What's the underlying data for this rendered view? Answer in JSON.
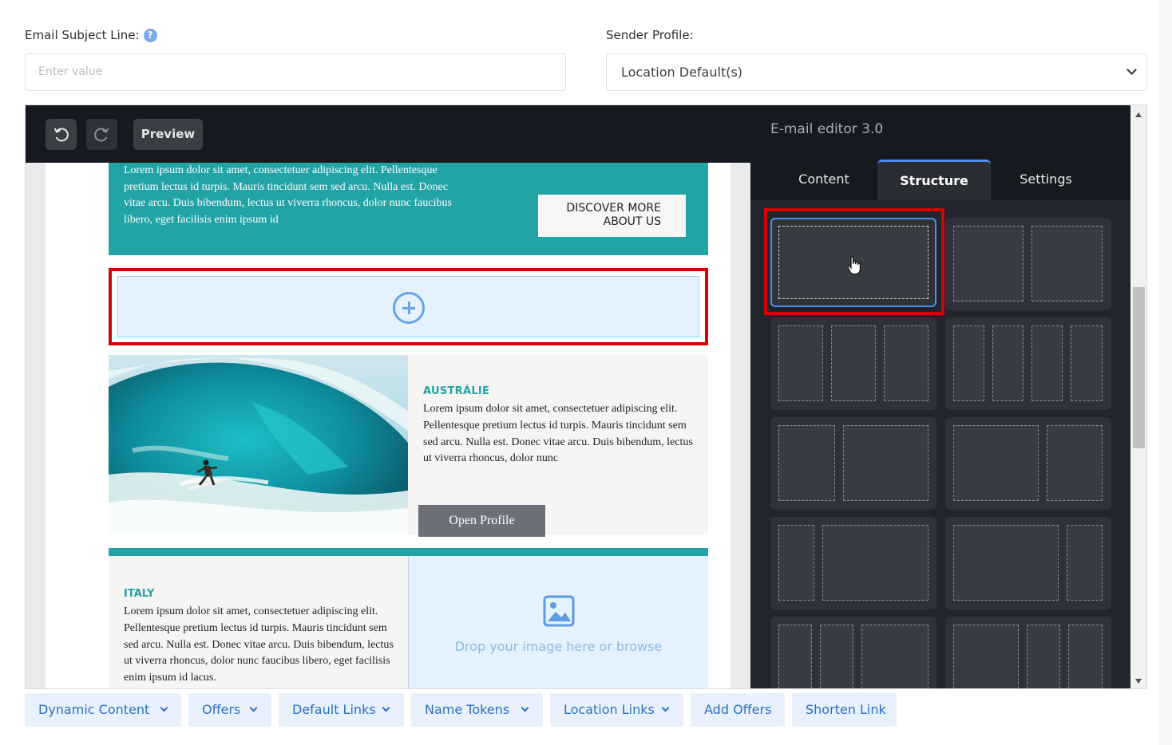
{
  "form": {
    "subject_label": "Email Subject Line:",
    "subject_help_icon": "?",
    "subject_placeholder": "Enter value",
    "sender_label": "Sender Profile:",
    "sender_value": "Location Default(s)"
  },
  "toolbar": {
    "undo_icon": "undo-icon",
    "redo_icon": "redo-icon",
    "preview_label": "Preview"
  },
  "canvas": {
    "teal_text": "Lorem ipsum dolor sit amet, consectetuer adipiscing elit. Pellentesque pretium lectus id turpis. Mauris tincidunt sem sed arcu. Nulla est. Donec vitae arcu. Duis bibendum, lectus ut viverra rhoncus, dolor nunc faucibus libero, eget facilisis enim ipsum id",
    "discover_label_1": "DISCOVER MORE",
    "discover_label_2": "ABOUT US",
    "australia_title": "AUSTRÁLIE",
    "australia_text": "Lorem ipsum dolor sit amet, consectetuer adipiscing elit. Pellentesque pretium lectus id turpis. Mauris tincidunt sem sed arcu. Nulla est. Donec vitae arcu. Duis bibendum, lectus ut viverra rhoncus, dolor nunc",
    "open_profile_label": "Open Profile",
    "italy_title": "ITALY",
    "italy_text": "Lorem ipsum dolor sit amet, consectetuer adipiscing elit. Pellentesque pretium lectus id turpis. Mauris tincidunt sem sed arcu. Nulla est. Donec vitae arcu. Duis bibendum, lectus ut viverra rhoncus, dolor nunc faucibus libero, eget facilisis enim ipsum id lacus.",
    "image_drop_text": "Drop your image here or browse"
  },
  "panel": {
    "title": "E-mail editor 3.0",
    "tabs": [
      "Content",
      "Structure",
      "Settings"
    ],
    "active_tab": "Structure"
  },
  "bottom_bar": {
    "buttons": [
      "Dynamic Content",
      "Offers",
      "Default Links",
      "Name Tokens",
      "Location Links",
      "Add Offers",
      "Shorten Link"
    ]
  },
  "colors": {
    "accent_teal": "#22a3a6",
    "highlight_red": "#d90000",
    "link_blue": "#2f6fc0",
    "active_tab_blue": "#4c8ff0"
  }
}
